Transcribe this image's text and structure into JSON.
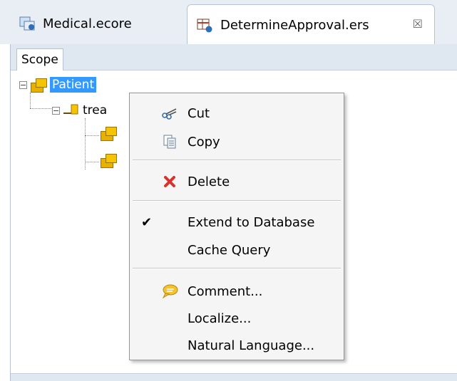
{
  "tabs": [
    {
      "label": "Medical.ecore",
      "icon": "ecore-model-icon",
      "active": false
    },
    {
      "label": "DetermineApproval.ers",
      "icon": "rule-table-icon",
      "active": true
    }
  ],
  "scope": {
    "tab_label": "Scope",
    "tree": {
      "root_label": "Patient",
      "child_label": "trea"
    }
  },
  "context_menu": {
    "items": [
      {
        "label": "Cut",
        "icon": "scissors-icon"
      },
      {
        "label": "Copy",
        "icon": "copy-icon"
      },
      {
        "label": "Delete",
        "icon": "delete-x-icon"
      },
      {
        "label": "Extend to Database",
        "checked": true
      },
      {
        "label": "Cache Query"
      },
      {
        "label": "Comment...",
        "icon": "comment-bubble-icon"
      },
      {
        "label": "Localize..."
      },
      {
        "label": "Natural Language..."
      }
    ]
  },
  "colors": {
    "selection": "#3399ff",
    "delete_icon": "#d9312b",
    "entity_icon": "#f4c400"
  }
}
